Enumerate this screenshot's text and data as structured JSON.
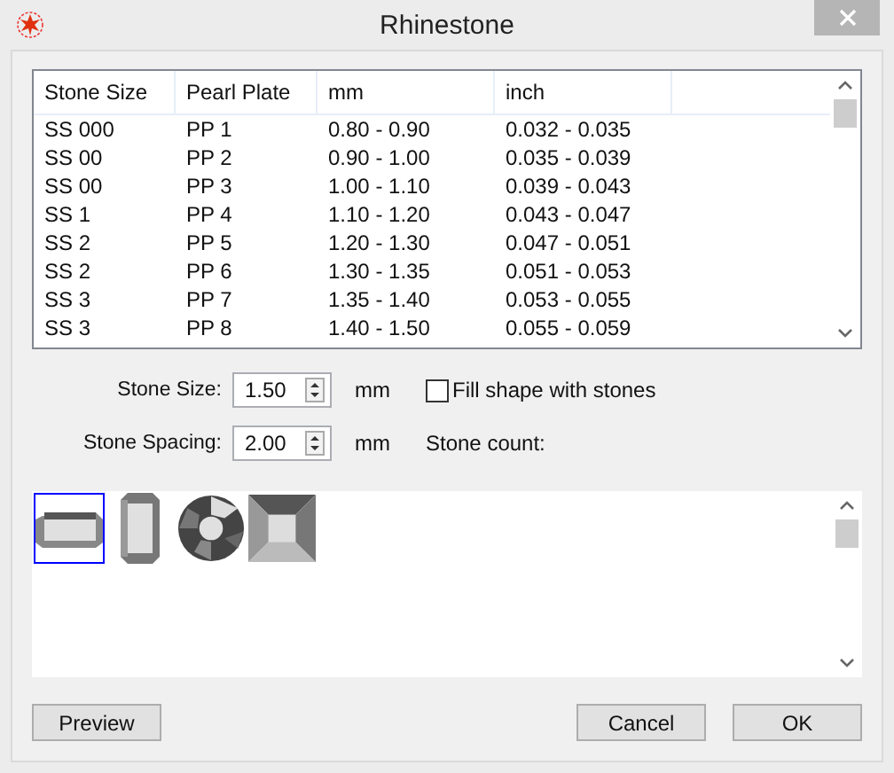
{
  "window": {
    "title": "Rhinestone"
  },
  "table": {
    "columns": [
      "Stone Size",
      "Pearl Plate",
      "mm",
      "inch"
    ],
    "rows": [
      [
        "SS 000",
        "PP 1",
        "0.80 - 0.90",
        "0.032 - 0.035"
      ],
      [
        "SS 00",
        "PP 2",
        "0.90 - 1.00",
        "0.035 - 0.039"
      ],
      [
        "SS 00",
        "PP 3",
        "1.00 - 1.10",
        "0.039 - 0.043"
      ],
      [
        "SS 1",
        "PP 4",
        "1.10 - 1.20",
        "0.043 - 0.047"
      ],
      [
        "SS 2",
        "PP 5",
        "1.20 - 1.30",
        "0.047 - 0.051"
      ],
      [
        "SS 2",
        "PP 6",
        "1.30 - 1.35",
        "0.051 - 0.053"
      ],
      [
        "SS 3",
        "PP 7",
        "1.35 - 1.40",
        "0.053 - 0.055"
      ],
      [
        "SS 3",
        "PP 8",
        "1.40 - 1.50",
        "0.055 - 0.059"
      ]
    ]
  },
  "fields": [
    {
      "label": "Stone Size:",
      "value": "1.50",
      "unit": "mm"
    },
    {
      "label": "Stone Spacing:",
      "value": "2.00",
      "unit": "mm"
    }
  ],
  "fill_shape": {
    "label": "Fill shape with stones",
    "checked": false
  },
  "stone_count": {
    "label": "Stone count:"
  },
  "shapes": [
    {
      "kind": "rectangle",
      "selected": true
    },
    {
      "kind": "baguette",
      "selected": false
    },
    {
      "kind": "round",
      "selected": false
    },
    {
      "kind": "square",
      "selected": false
    }
  ],
  "buttons": {
    "preview": "Preview",
    "cancel": "Cancel",
    "ok": "OK"
  }
}
